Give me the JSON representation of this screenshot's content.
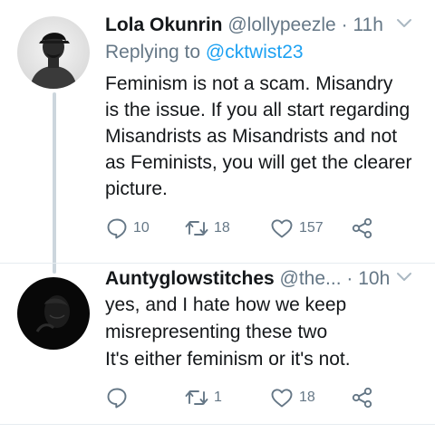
{
  "tweets": [
    {
      "name": "Lola Okunrin",
      "handle": "@lollypeezle",
      "separator": "·",
      "time": "11h",
      "reply_prefix": "Replying to",
      "reply_mention": "@cktwist23",
      "text": "Feminism is not a scam. Misandry\nis the issue. If you all start regarding\nMisandrists as Misandrists and not\nas Feminists, you will get the clearer\npicture.",
      "replies": "10",
      "retweets": "18",
      "likes": "157"
    },
    {
      "name": "Auntyglowstitches",
      "handle": "@the...",
      "separator": "·",
      "time": "10h",
      "text": "yes,  and I hate how we keep\nmisrepresenting these two\nIt's either feminism or it's not.",
      "replies": "",
      "retweets": "1",
      "likes": "18"
    }
  ],
  "icons": {
    "reply": "speech-bubble-icon",
    "retweet": "retweet-arrows-icon",
    "like": "heart-outline-icon",
    "share": "share-nodes-icon",
    "menu": "chevron-down-icon"
  },
  "colors": {
    "text": "#14171a",
    "secondary": "#657786",
    "link": "#1da1f2",
    "thread_line": "#ccd6dd",
    "divider": "#e6ecf0"
  }
}
